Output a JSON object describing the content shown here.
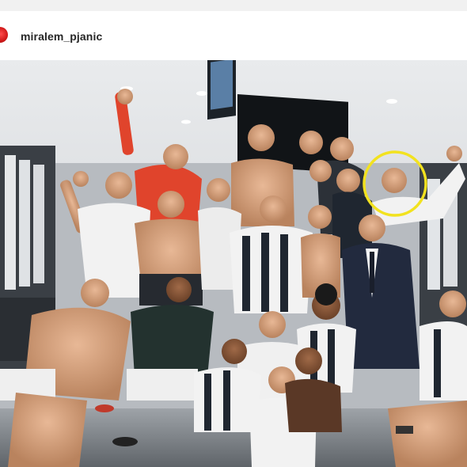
{
  "post": {
    "username": "miralem_pjanic"
  },
  "photo": {
    "highlight_color": "#f2e21f",
    "accent_shirt": "#e0442c",
    "kit_dark": "#1f2630",
    "kit_white": "#f2f2f2"
  },
  "icons": {
    "avatar": "profile-avatar-icon"
  }
}
